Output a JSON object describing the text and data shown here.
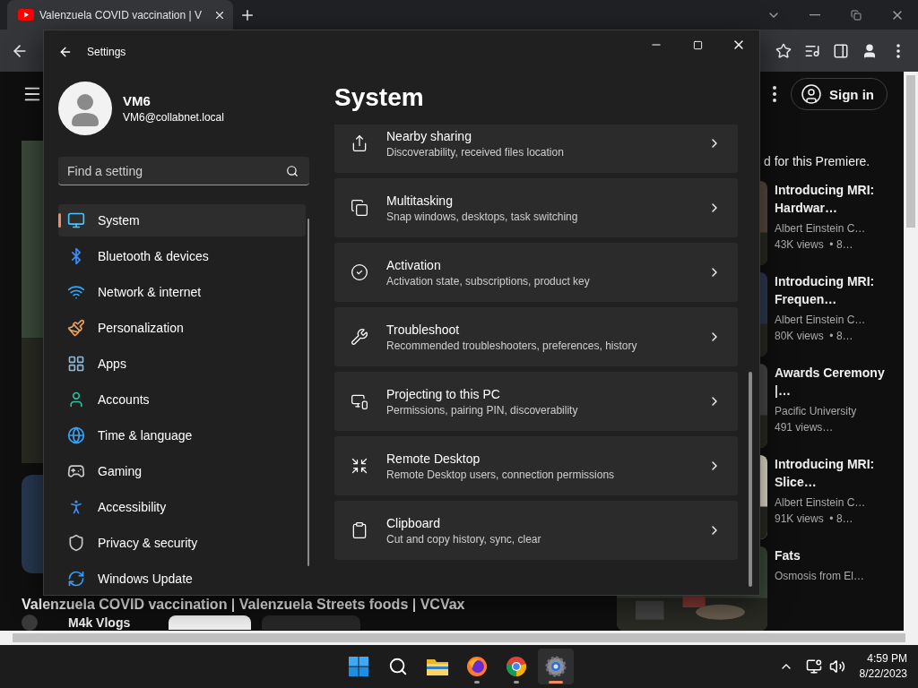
{
  "browser": {
    "tabs": [
      {
        "title": "Valenzuela COVID vaccination | V",
        "selected": true
      }
    ]
  },
  "youtube": {
    "sign_in": "Sign in",
    "premiere_note": "d for this Premiere.",
    "video_title": "Valenzuela COVID vaccination | Valenzuela Streets foods | VCVax",
    "channel": "M4k Vlogs",
    "up_next": [
      {
        "title": "Introducing MRI: Hardwar…",
        "channel": "Albert Einstein C…",
        "meta": "43K views  • 8…"
      },
      {
        "title": "Introducing MRI: Frequen…",
        "channel": "Albert Einstein C…",
        "meta": "80K views  • 8…"
      },
      {
        "title": "Awards Ceremony |…",
        "channel": "Pacific University",
        "meta": "491 views…"
      },
      {
        "title": "Introducing MRI: Slice…",
        "channel": "Albert Einstein C…",
        "meta": "91K views  • 8…"
      },
      {
        "title": "Fats",
        "channel": "Osmosis from El…"
      }
    ]
  },
  "settings": {
    "window_title": "Settings",
    "user": {
      "name": "VM6",
      "email": "VM6@collabnet.local"
    },
    "search": {
      "placeholder": "Find a setting"
    },
    "nav": [
      {
        "label": "System",
        "selected": true
      },
      {
        "label": "Bluetooth & devices",
        "selected": false
      },
      {
        "label": "Network & internet",
        "selected": false
      },
      {
        "label": "Personalization",
        "selected": false
      },
      {
        "label": "Apps",
        "selected": false
      },
      {
        "label": "Accounts",
        "selected": false
      },
      {
        "label": "Time & language",
        "selected": false
      },
      {
        "label": "Gaming",
        "selected": false
      },
      {
        "label": "Accessibility",
        "selected": false
      },
      {
        "label": "Privacy & security",
        "selected": false
      },
      {
        "label": "Windows Update",
        "selected": false
      }
    ],
    "page_title": "System",
    "cards": [
      {
        "title": "Nearby sharing",
        "description": "Discoverability, received files location"
      },
      {
        "title": "Multitasking",
        "description": "Snap windows, desktops, task switching"
      },
      {
        "title": "Activation",
        "description": "Activation state, subscriptions, product key"
      },
      {
        "title": "Troubleshoot",
        "description": "Recommended troubleshooters, preferences, history"
      },
      {
        "title": "Projecting to this PC",
        "description": "Permissions, pairing PIN, discoverability"
      },
      {
        "title": "Remote Desktop",
        "description": "Remote Desktop users, connection permissions"
      },
      {
        "title": "Clipboard",
        "description": "Cut and copy history, sync, clear"
      }
    ]
  },
  "taskbar": {
    "apps": [
      {
        "selected": false,
        "running": false
      },
      {
        "selected": false,
        "running": false
      },
      {
        "selected": false,
        "running": false
      },
      {
        "selected": false,
        "running": true
      },
      {
        "selected": false,
        "running": true
      },
      {
        "selected": true,
        "running": true
      }
    ],
    "time": "4:59 PM",
    "date": "8/22/2023"
  }
}
